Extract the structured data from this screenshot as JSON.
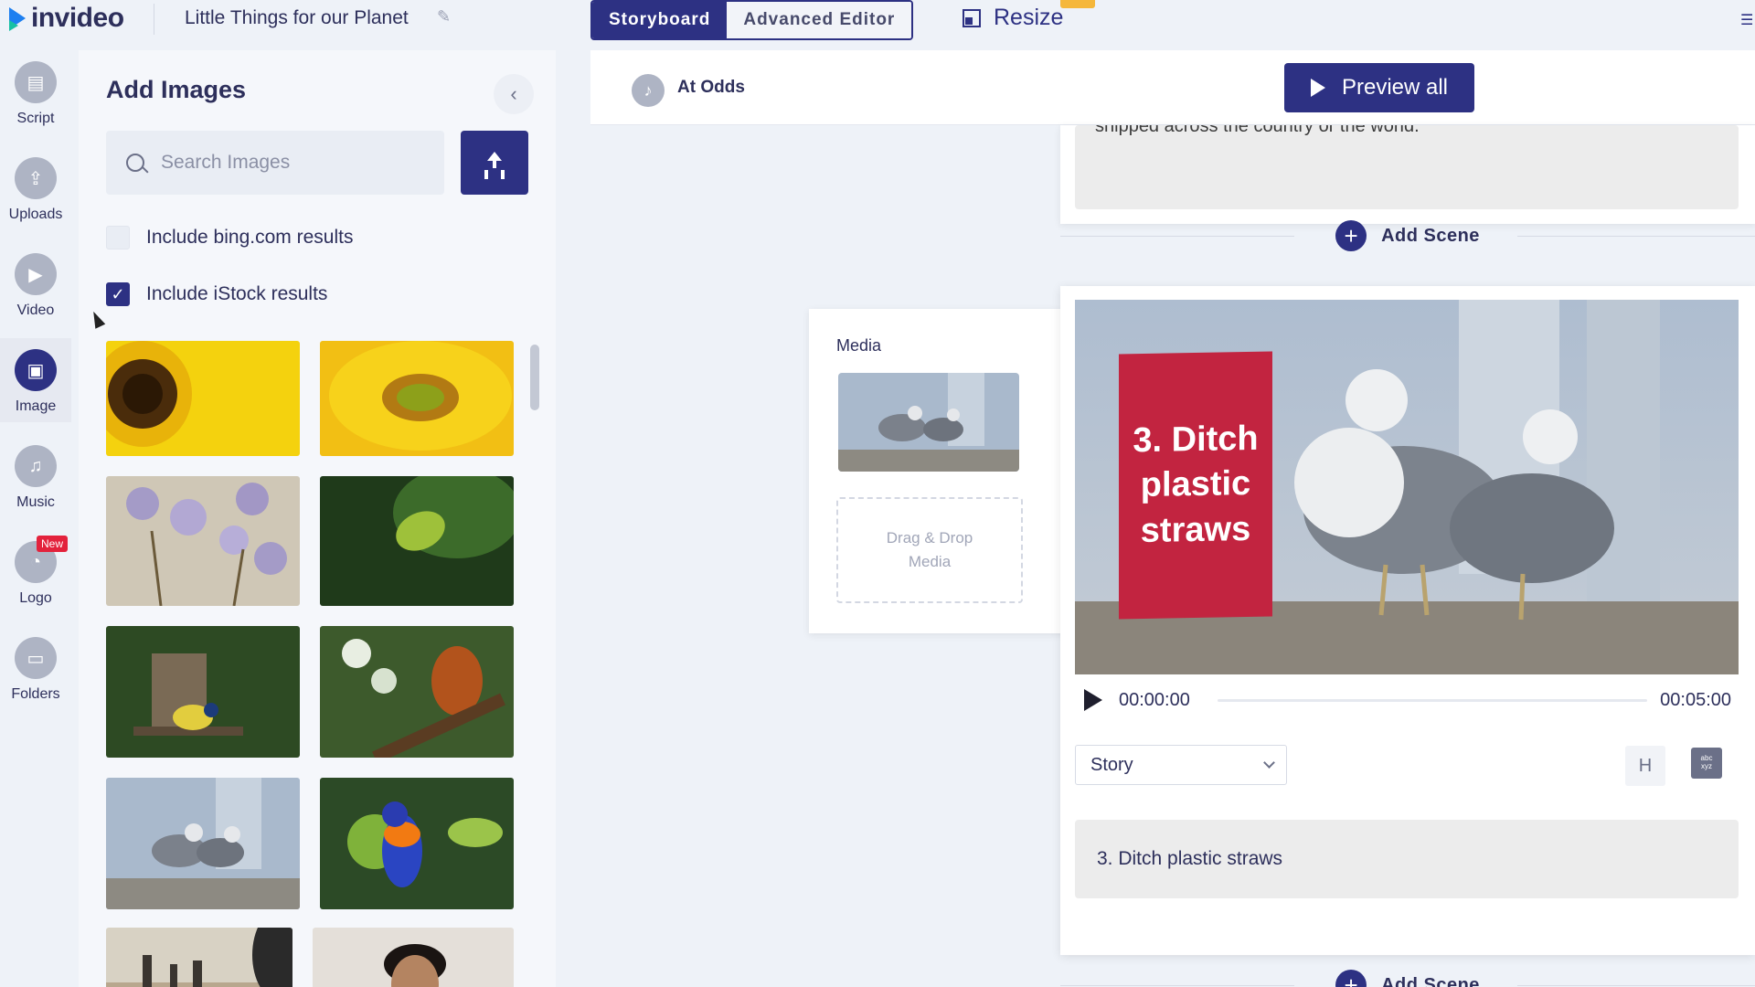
{
  "app": {
    "logo_text": "invideo",
    "project_title": "Little Things for our Planet"
  },
  "modes": {
    "storyboard": "Storyboard",
    "advanced": "Advanced Editor"
  },
  "resize": {
    "label": "Resize"
  },
  "rail": {
    "items": [
      {
        "label": "Script",
        "icon": "script-icon"
      },
      {
        "label": "Uploads",
        "icon": "upload-icon"
      },
      {
        "label": "Video",
        "icon": "video-icon"
      },
      {
        "label": "Image",
        "icon": "image-icon",
        "active": true
      },
      {
        "label": "Music",
        "icon": "music-note-icon"
      },
      {
        "label": "Logo",
        "icon": "logo-icon",
        "badge": "New"
      },
      {
        "label": "Folders",
        "icon": "folder-icon"
      }
    ]
  },
  "panel": {
    "title": "Add Images",
    "search_placeholder": "Search Images",
    "bing_label": "Include bing.com results",
    "bing_checked": false,
    "istock_label": "Include iStock results",
    "istock_checked": true
  },
  "music": {
    "title": "At Odds"
  },
  "preview": {
    "label": "Preview all"
  },
  "prev_scene": {
    "text": "shipped across the country or the world."
  },
  "add_scene": {
    "label": "Add Scene"
  },
  "media": {
    "label": "Media",
    "drop_label": "Drag & Drop Media"
  },
  "scene": {
    "caption": "3. Ditch plastic straws",
    "time_current": "00:00:00",
    "time_end": "00:05:00",
    "type": "Story",
    "h_label": "H",
    "abc_top": "abc",
    "abc_bottom": "xyz",
    "text": "3. Ditch plastic straws"
  },
  "colors": {
    "primary": "#2d3183",
    "accent_red": "#c22440",
    "badge_red": "#e3223c"
  }
}
